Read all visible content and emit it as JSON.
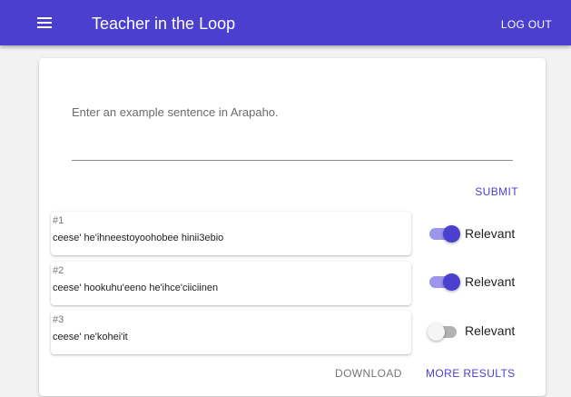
{
  "app_bar": {
    "title": "Teacher in the Loop",
    "logout_label": "LOG OUT",
    "background_color": "#4a3fcf"
  },
  "input": {
    "placeholder": "Enter an example sentence in Arapaho.",
    "value": ""
  },
  "submit_label": "SUBMIT",
  "results": [
    {
      "index": "#1",
      "text": "ceese' he'ihneestoyoohobee hinii3ebio",
      "relevant": true,
      "label": "Relevant"
    },
    {
      "index": "#2",
      "text": "ceese' hookuhu'eeno he'ihce'ciiciinen",
      "relevant": true,
      "label": "Relevant"
    },
    {
      "index": "#3",
      "text": "ceese' ne'kohei'it",
      "relevant": false,
      "label": "Relevant"
    }
  ],
  "footer": {
    "download_label": "DOWNLOAD",
    "more_results_label": "MORE RESULTS"
  },
  "icons": {
    "menu": "menu-icon"
  }
}
